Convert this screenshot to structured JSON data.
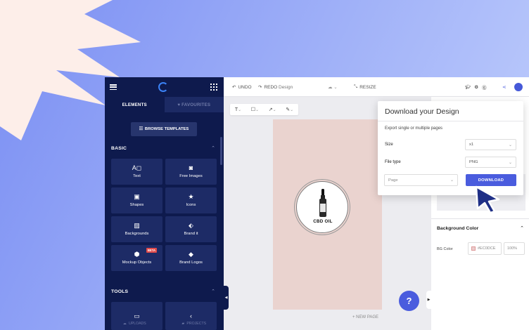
{
  "colors": {
    "accent": "#4a5cde",
    "sidebar": "#0e1a4d",
    "canvas": "#ead3cf"
  },
  "sidebar": {
    "tabs": [
      {
        "label": "ELEMENTS"
      },
      {
        "label": "FAVOURITES"
      }
    ],
    "browse_label": "BROWSE TEMPLATES",
    "basic_heading": "BASIC",
    "tools_heading": "TOOLS",
    "items": [
      {
        "label": "Text",
        "icon": "text-icon"
      },
      {
        "label": "Free Images",
        "icon": "camera-icon"
      },
      {
        "label": "Shapes",
        "icon": "image-icon"
      },
      {
        "label": "Icons",
        "icon": "star-icon"
      },
      {
        "label": "Backgrounds",
        "icon": "stripes-icon"
      },
      {
        "label": "Brand it",
        "icon": "tag-icon"
      },
      {
        "label": "Mockup Objects",
        "icon": "cube-icon",
        "badge": "BETA"
      },
      {
        "label": "Brand Logos",
        "icon": "diamond-icon"
      }
    ],
    "bottom": [
      {
        "label": "UPLOADS"
      },
      {
        "label": "PROJECTS"
      }
    ]
  },
  "topbar": {
    "undo": "UNDO",
    "redo": "REDO",
    "design": "Design",
    "resize": "RESIZE"
  },
  "canvas": {
    "product_text": "CBD OIL",
    "new_page": "+ NEW PAGE"
  },
  "help": "?",
  "right_panel": {
    "bg_title": "Background Color",
    "bg_label": "BG Color",
    "bg_value": "#EC0DCE",
    "bg_opacity": "100%"
  },
  "download": {
    "title": "Download your Design",
    "subtitle": "Export single or multiple pages",
    "size_label": "Size",
    "size_value": "x1",
    "filetype_label": "File type",
    "filetype_value": "PNG",
    "page_placeholder": "Page",
    "button": "DOWNLOAD"
  }
}
